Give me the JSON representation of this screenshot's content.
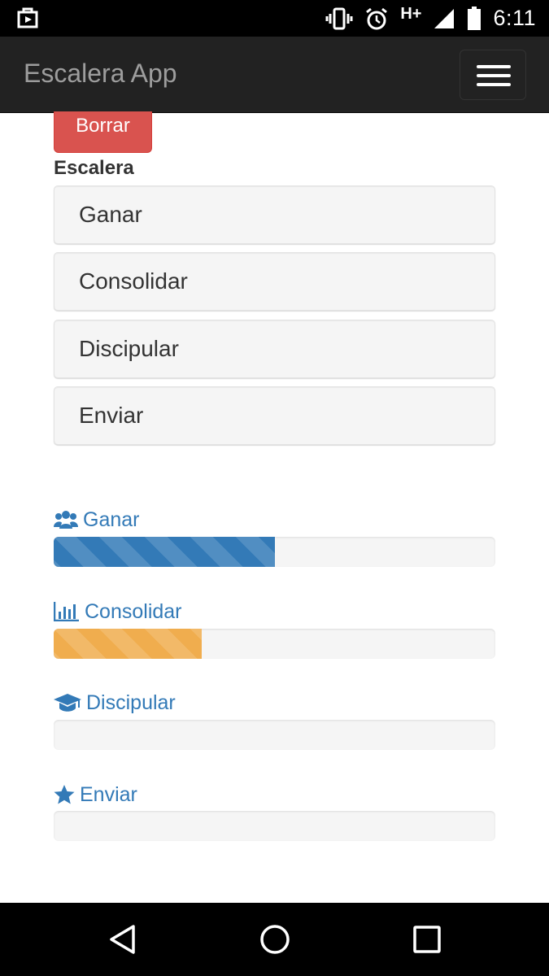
{
  "status_bar": {
    "network": "H+",
    "time": "6:11",
    "icons": [
      "store-bag-icon",
      "vibrate-icon",
      "alarm-icon",
      "signal-icon",
      "battery-icon"
    ]
  },
  "navbar": {
    "brand": "Escalera App",
    "toggle_icon": "hamburger-menu-icon"
  },
  "content": {
    "delete_button": "Borrar",
    "section_title": "Escalera",
    "steps": [
      "Ganar",
      "Consolidar",
      "Discipular",
      "Enviar"
    ]
  },
  "progress": [
    {
      "label": "Ganar",
      "icon": "users-icon",
      "percent": 50,
      "color": "#337ab7"
    },
    {
      "label": "Consolidar",
      "icon": "bar-chart-icon",
      "percent": 33.5,
      "color": "#f0ad4e"
    },
    {
      "label": "Discipular",
      "icon": "graduation-cap-icon",
      "percent": 0,
      "color": "#337ab7"
    },
    {
      "label": "Enviar",
      "icon": "star-icon",
      "percent": 0,
      "color": "#337ab7"
    }
  ],
  "colors": {
    "navbar_bg": "#222222",
    "brand_text": "#9d9d9d",
    "danger": "#d9534f",
    "primary": "#337ab7",
    "warning": "#f0ad4e"
  }
}
